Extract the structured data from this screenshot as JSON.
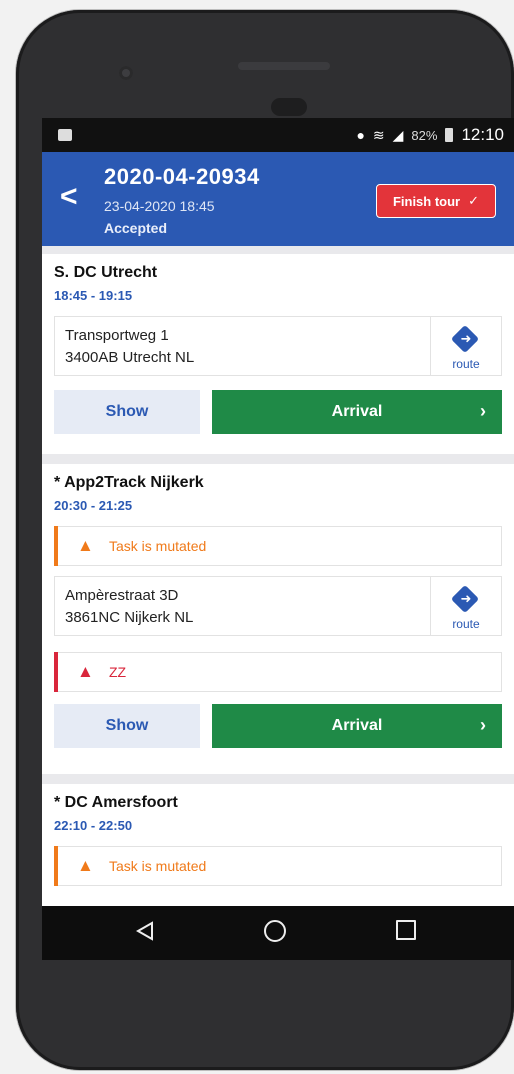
{
  "status_bar": {
    "battery": "82%",
    "time": "12:10"
  },
  "header": {
    "title": "2020-04-20934",
    "date": "23-04-2020 18:45",
    "status": "Accepted",
    "finish_label": "Finish tour",
    "finish_icon": "✓"
  },
  "stops": [
    {
      "name": "S. DC Utrecht",
      "time": "18:45 - 19:15",
      "address_line1": "Transportweg 1",
      "address_line2": "3400AB Utrecht NL",
      "route_label": "route",
      "show_label": "Show",
      "arrival_label": "Arrival",
      "arrival_chevron": "›"
    },
    {
      "name": "* App2Track Nijkerk",
      "time": "20:30 - 21:25",
      "alert_mutated": "Task is mutated",
      "address_line1": "Ampèrestraat 3D",
      "address_line2": "3861NC Nijkerk NL",
      "route_label": "route",
      "alert_zz": "ZZ",
      "show_label": "Show",
      "arrival_label": "Arrival",
      "arrival_chevron": "›"
    },
    {
      "name": "* DC Amersfoort",
      "time": "22:10 - 22:50",
      "alert_mutated": "Task is mutated"
    }
  ],
  "colors": {
    "primary": "#2b59b3",
    "finish": "#e3343a",
    "arrival": "#1f8a47",
    "warning_orange": "#f07a1a",
    "danger_red": "#d9263b"
  }
}
